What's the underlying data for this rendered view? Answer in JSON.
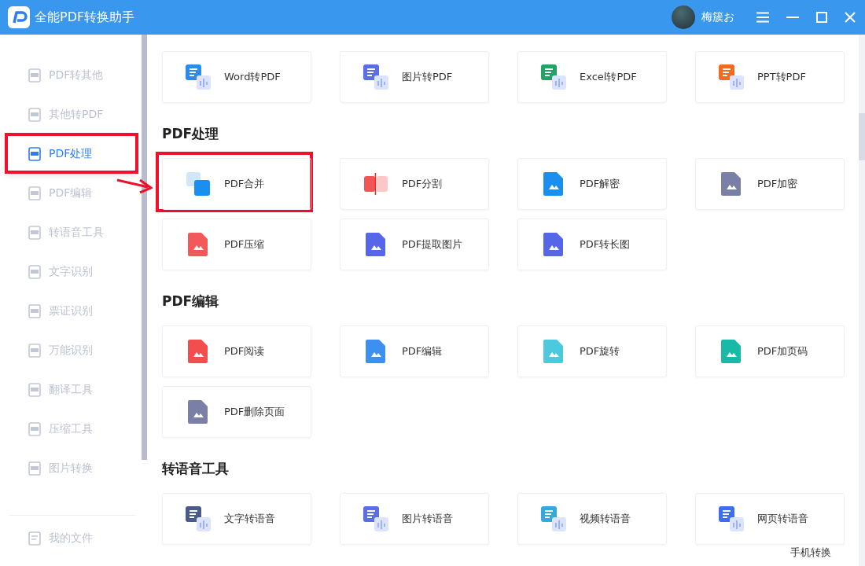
{
  "window": {
    "title": "全能PDF转换助手",
    "user_name": "梅簇お"
  },
  "sidebar": {
    "items": [
      {
        "label": "PDF转其他",
        "selected": false,
        "callout": false
      },
      {
        "label": "其他转PDF",
        "selected": false,
        "callout": false
      },
      {
        "label": "PDF处理",
        "selected": true,
        "callout": true
      },
      {
        "label": "PDF编辑",
        "selected": false,
        "callout": false
      },
      {
        "label": "转语音工具",
        "selected": false,
        "callout": false
      },
      {
        "label": "文字识别",
        "selected": false,
        "callout": false
      },
      {
        "label": "票证识别",
        "selected": false,
        "callout": false
      },
      {
        "label": "万能识别",
        "selected": false,
        "callout": false
      },
      {
        "label": "翻译工具",
        "selected": false,
        "callout": false
      },
      {
        "label": "压缩工具",
        "selected": false,
        "callout": false
      },
      {
        "label": "图片转换",
        "selected": false,
        "callout": false
      }
    ],
    "footer": "我的文件"
  },
  "sections": [
    {
      "cards": [
        {
          "label": "Word转PDF",
          "callout": false
        },
        {
          "label": "图片转PDF",
          "callout": false
        },
        {
          "label": "Excel转PDF",
          "callout": false
        },
        {
          "label": "PPT转PDF",
          "callout": false
        }
      ]
    },
    {
      "title": "PDF处理",
      "cards": [
        {
          "label": "PDF合并",
          "callout": true
        },
        {
          "label": "PDF分割",
          "callout": false
        },
        {
          "label": "PDF解密",
          "callout": false
        },
        {
          "label": "PDF加密",
          "callout": false
        },
        {
          "label": "PDF压缩",
          "callout": false
        },
        {
          "label": "PDF提取图片",
          "callout": false
        },
        {
          "label": "PDF转长图",
          "callout": false
        }
      ]
    },
    {
      "title": "PDF编辑",
      "cards": [
        {
          "label": "PDF阅读",
          "callout": false
        },
        {
          "label": "PDF编辑",
          "callout": false
        },
        {
          "label": "PDF旋转",
          "callout": false
        },
        {
          "label": "PDF加页码",
          "callout": false
        },
        {
          "label": "PDF删除页面",
          "callout": false
        }
      ]
    },
    {
      "title": "转语音工具",
      "cards": [
        {
          "label": "文字转语音",
          "callout": false
        },
        {
          "label": "图片转语音",
          "callout": false
        },
        {
          "label": "视频转语音",
          "callout": false
        },
        {
          "label": "网页转语音",
          "callout": false
        }
      ]
    }
  ],
  "floating_link": "手机转换"
}
